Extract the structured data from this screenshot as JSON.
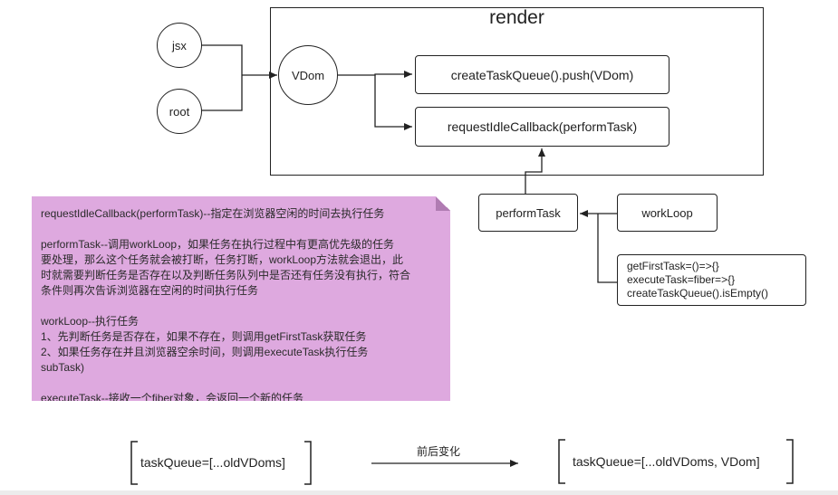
{
  "render": {
    "title": "render"
  },
  "nodes": {
    "jsx": "jsx",
    "root": "root",
    "vdom": "VDom",
    "createTaskQueue": "createTaskQueue().push(VDom)",
    "requestIdleCallback": "requestIdleCallback(performTask)",
    "performTask": "performTask",
    "workLoop": "workLoop"
  },
  "functions": [
    "getFirstTask=()=>{}",
    "executeTask=fiber=>{}",
    "createTaskQueue().isEmpty()"
  ],
  "note": {
    "p1": [
      "requestIdleCallback(performTask)--指定在浏览器空闲的时间去执行任务"
    ],
    "p2": [
      "performTask--调用workLoop，如果任务在执行过程中有更高优先级的任务",
      "要处理，那么这个任务就会被打断，任务打断，workLoop方法就会退出，此",
      "时就需要判断任务是否存在以及判断任务队列中是否还有任务没有执行，符合",
      "条件则再次告诉浏览器在空闲的时间执行任务"
    ],
    "p3": [
      "workLoop--执行任务",
      "1、先判断任务是否存在，如果不存在，则调用getFirstTask获取任务",
      "2、如果任务存在并且浏览器空余时间，则调用executeTask执行任务",
      "subTask)"
    ],
    "p4": [
      "executeTask--接收一个fiber对象，会返回一个新的任务"
    ]
  },
  "queue": {
    "before": "taskQueue=[...oldVDoms]",
    "arrow_label": "前后变化",
    "after": "taskQueue=[...oldVDoms, VDom]"
  }
}
